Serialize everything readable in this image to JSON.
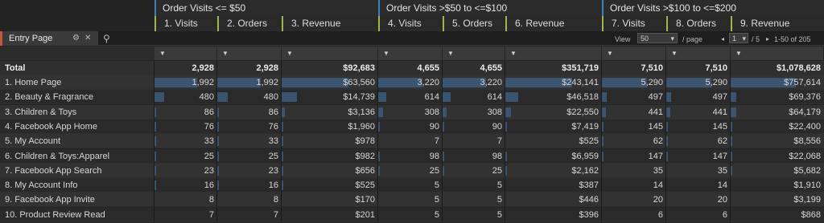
{
  "groups": [
    {
      "label": "Order Visits <= $50"
    },
    {
      "label": "Order Visits >$50 to <=$100"
    },
    {
      "label": "Order Visits >$100 to <=$200"
    }
  ],
  "metric_headers": [
    "1. Visits",
    "2. Orders",
    "3. Revenue",
    "4. Visits",
    "5. Orders",
    "6. Revenue",
    "7. Visits",
    "8. Orders",
    "9. Revenue"
  ],
  "toolbar": {
    "dimension_label": "Entry Page",
    "view_label": "View",
    "view_value": "50",
    "per_page_label": "/ page",
    "page_value": "1",
    "page_total": "/ 5",
    "range_label": "1-50 of 205",
    "sort_arrow": "▼"
  },
  "total": {
    "label": "Total",
    "values": [
      "2,928",
      "2,928",
      "$92,683",
      "4,655",
      "4,655",
      "$351,719",
      "7,510",
      "7,510",
      "$1,078,628"
    ]
  },
  "rows": [
    {
      "label": "1.  Home Page",
      "values": [
        "1,992",
        "1,992",
        "$63,560",
        "3,220",
        "3,220",
        "$243,141",
        "5,290",
        "5,290",
        "$757,614"
      ],
      "bars": [
        0.68,
        0.68,
        0.69,
        0.69,
        0.69,
        0.69,
        0.7,
        0.7,
        0.7
      ]
    },
    {
      "label": "2.  Beauty & Fragrance",
      "values": [
        "480",
        "480",
        "$14,739",
        "614",
        "614",
        "$46,518",
        "497",
        "497",
        "$69,376"
      ],
      "bars": [
        0.16,
        0.16,
        0.16,
        0.13,
        0.13,
        0.13,
        0.07,
        0.07,
        0.06
      ]
    },
    {
      "label": "3.  Children & Toys",
      "values": [
        "86",
        "86",
        "$3,136",
        "308",
        "308",
        "$22,550",
        "441",
        "441",
        "$64,179"
      ],
      "bars": [
        0.03,
        0.03,
        0.03,
        0.07,
        0.07,
        0.06,
        0.06,
        0.06,
        0.06
      ]
    },
    {
      "label": "4.  Facebook App Home",
      "values": [
        "76",
        "76",
        "$1,960",
        "90",
        "90",
        "$7,419",
        "145",
        "145",
        "$22,400"
      ],
      "bars": [
        0.03,
        0.03,
        0.02,
        0.02,
        0.02,
        0.02,
        0.02,
        0.02,
        0.02
      ]
    },
    {
      "label": "5.  My Account",
      "values": [
        "33",
        "33",
        "$978",
        "7",
        "7",
        "$525",
        "62",
        "62",
        "$8,556"
      ],
      "bars": [
        0.01,
        0.01,
        0.01,
        0,
        0,
        0,
        0.01,
        0.01,
        0.01
      ]
    },
    {
      "label": "6.  Children & Toys:Apparel",
      "values": [
        "25",
        "25",
        "$982",
        "98",
        "98",
        "$6,959",
        "147",
        "147",
        "$22,068"
      ],
      "bars": [
        0.01,
        0.01,
        0.01,
        0.02,
        0.02,
        0.02,
        0.02,
        0.02,
        0.02
      ]
    },
    {
      "label": "7.  Facebook App Search",
      "values": [
        "23",
        "23",
        "$656",
        "25",
        "25",
        "$2,162",
        "35",
        "35",
        "$5,682"
      ],
      "bars": [
        0.01,
        0.01,
        0.01,
        0.01,
        0.01,
        0.01,
        0,
        0,
        0.01
      ]
    },
    {
      "label": "8.  My Account Info",
      "values": [
        "16",
        "16",
        "$525",
        "5",
        "5",
        "$387",
        "14",
        "14",
        "$1,910"
      ],
      "bars": [
        0.01,
        0.01,
        0.01,
        0,
        0,
        0,
        0,
        0,
        0
      ]
    },
    {
      "label": "9.  Facebook App Invite",
      "values": [
        "8",
        "8",
        "$170",
        "5",
        "5",
        "$446",
        "20",
        "20",
        "$3,199"
      ],
      "bars": [
        0,
        0,
        0,
        0,
        0,
        0,
        0,
        0,
        0
      ]
    },
    {
      "label": "10.  Product Review Read",
      "values": [
        "7",
        "7",
        "$201",
        "5",
        "5",
        "$396",
        "6",
        "6",
        "$868"
      ],
      "bars": [
        0,
        0,
        0,
        0,
        0,
        0,
        0,
        0,
        0
      ]
    }
  ]
}
